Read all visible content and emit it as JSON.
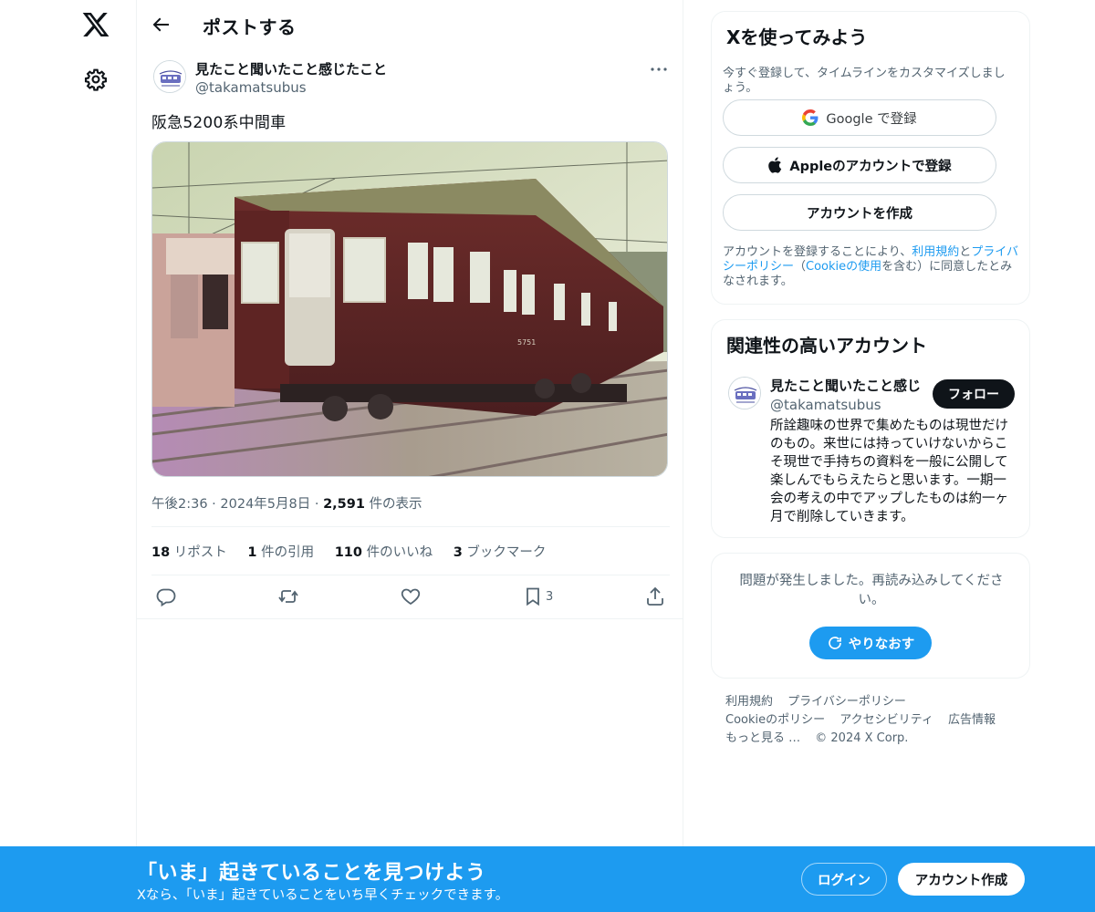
{
  "header": {
    "title": "ポストする"
  },
  "tweet": {
    "author_name": "見たこと聞いたこと感じたこと",
    "author_handle": "@takamatsubus",
    "text": "阪急5200系中間車",
    "time": "午後2:36",
    "date": "2024年5月8日",
    "views_count": "2,591",
    "views_label": "件の表示",
    "reposts_count": "18",
    "reposts_label": "リポスト",
    "quotes_count": "1",
    "quotes_label": "件の引用",
    "likes_count": "110",
    "likes_label": "件のいいね",
    "bookmarks_count": "3",
    "bookmarks_label": "ブックマーク",
    "bookmark_action_count": "3",
    "image_caption": "5751"
  },
  "signup_card": {
    "title": "Xを使ってみよう",
    "subtitle": "今すぐ登録して、タイムラインをカスタマイズしましょう。",
    "google_label": "Google で登録",
    "apple_label": "Appleのアカウントで登録",
    "create_label": "アカウントを作成",
    "legal_prefix": "アカウントを登録することにより、",
    "legal_terms": "利用規約",
    "legal_and": "と",
    "legal_privacy": "プライバシーポリシー",
    "legal_paren_open": "（",
    "legal_cookie": "Cookieの使用",
    "legal_suffix": "を含む）に同意したとみなされます。"
  },
  "related": {
    "title": "関連性の高いアカウント",
    "name": "見たこと聞いたこと感じ",
    "handle": "@takamatsubus",
    "follow_label": "フォロー",
    "bio": "所詮趣味の世界で集めたものは現世だけのもの。来世には持っていけないからこそ現世で手持ちの資料を一般に公開して楽しんでもらえたらと思います。一期一会の考えの中でアップしたものは約一ヶ月で削除していきます。"
  },
  "error_card": {
    "message": "問題が発生しました。再読み込みしてください。",
    "retry_label": "やりなおす"
  },
  "footer": {
    "terms": "利用規約",
    "privacy": "プライバシーポリシー",
    "cookie": "Cookieのポリシー",
    "accessibility": "アクセシビリティ",
    "ads": "広告情報",
    "more": "もっと見る …",
    "copyright": "© 2024 X Corp."
  },
  "banner": {
    "title": "「いま」起きていることを見つけよう",
    "subtitle": "Xなら、「いま」起きていることをいち早くチェックできます。",
    "login_label": "ログイン",
    "signup_label": "アカウント作成"
  },
  "colors": {
    "accent": "#1d9bf0",
    "text": "#0f1419",
    "muted": "#536471",
    "border": "#eff3f4"
  }
}
